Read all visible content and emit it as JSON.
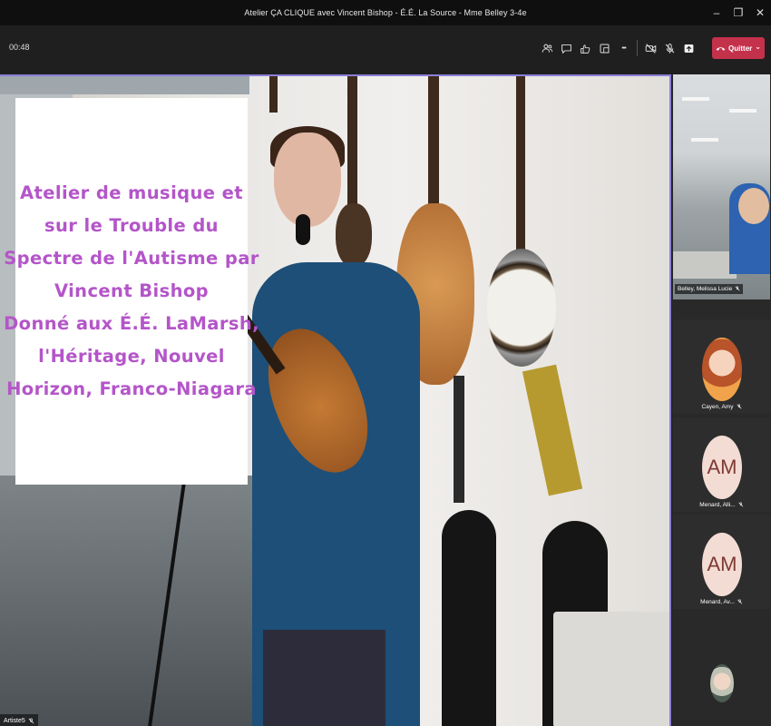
{
  "window": {
    "title": "Atelier ÇA CLIQUE avec Vincent Bishop - É.É. La Source - Mme Belley 3-4e",
    "minimize": "–",
    "restore": "❐",
    "close": "✕"
  },
  "toolbar": {
    "timer": "00:48",
    "leave_label": "Quitter",
    "leave_chevron": "⌄",
    "icons": [
      "participants-icon",
      "chat-icon",
      "reactions-icon",
      "rooms-icon",
      "more-icon",
      "camera-off-icon",
      "mic-off-icon",
      "share-icon"
    ],
    "more_glyph": "•••"
  },
  "stage": {
    "card_lines": [
      "Atelier de musique et",
      "sur le Trouble du",
      "Spectre de l'Autisme par",
      "Vincent Bishop",
      "Donné aux É.É. LaMarsh,",
      "l'Héritage, Nouvel",
      "Horizon, Franco-Niagara"
    ],
    "speaker_name": "Artiste5"
  },
  "participants": [
    {
      "name": "Belley, Melissa Lucie",
      "kind": "video"
    },
    {
      "name": "Cayen, Amy",
      "kind": "photo"
    },
    {
      "name": "Menard, Alli...",
      "kind": "initials",
      "initials": "AM"
    },
    {
      "name": "Menard, Av...",
      "kind": "initials",
      "initials": "AM"
    }
  ],
  "colors": {
    "accent_border": "#8b7fd8",
    "card_text": "#b455c9",
    "leave_button": "#c4314b"
  }
}
